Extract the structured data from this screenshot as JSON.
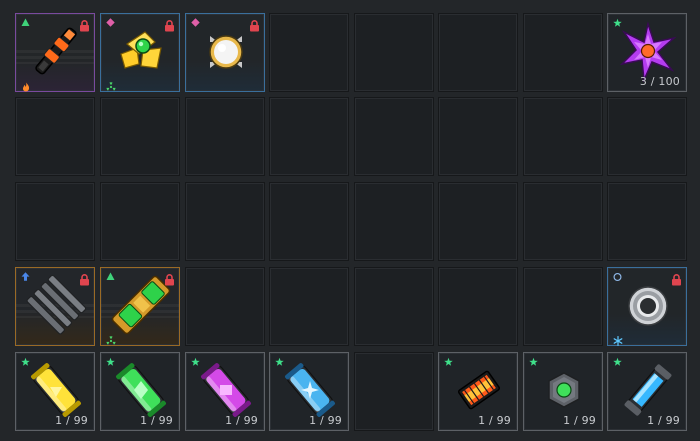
{
  "inventory": {
    "columns": 8,
    "rows": 5,
    "slots": [
      {
        "row": 0,
        "col": 0,
        "item": "orange-rod-icon",
        "rarity": "purple",
        "badge": "green-triangle",
        "locked": true,
        "sub": "fire-icon"
      },
      {
        "row": 0,
        "col": 1,
        "item": "yellow-turret-icon",
        "rarity": "blue",
        "badge": "pink-diamond",
        "locked": true,
        "sub": "radiation-icon"
      },
      {
        "row": 0,
        "col": 2,
        "item": "white-orb-icon",
        "rarity": "blue",
        "badge": "pink-diamond",
        "locked": true
      },
      {
        "row": 0,
        "col": 7,
        "item": "purple-shuriken-icon",
        "rarity": "gray",
        "badge": "green-star",
        "count": "3 / 100"
      },
      {
        "row": 3,
        "col": 0,
        "item": "gray-coil-icon",
        "rarity": "orange",
        "badge": "blue-arrow",
        "locked": true
      },
      {
        "row": 3,
        "col": 1,
        "item": "gold-green-cannon-icon",
        "rarity": "orange",
        "badge": "green-triangle",
        "locked": true,
        "sub": "radiation-icon"
      },
      {
        "row": 3,
        "col": 7,
        "item": "silver-ring-icon",
        "rarity": "blue",
        "badge": "blue-circle",
        "locked": true,
        "sub": "snowflake-icon"
      },
      {
        "row": 4,
        "col": 0,
        "item": "yellow-capsule-icon",
        "rarity": "gray",
        "badge": "green-star",
        "count": "1 / 99"
      },
      {
        "row": 4,
        "col": 1,
        "item": "green-capsule-icon",
        "rarity": "gray",
        "badge": "green-star",
        "count": "1 / 99"
      },
      {
        "row": 4,
        "col": 2,
        "item": "magenta-capsule-icon",
        "rarity": "gray",
        "badge": "green-star",
        "count": "1 / 99"
      },
      {
        "row": 4,
        "col": 3,
        "item": "blue-capsule-icon",
        "rarity": "gray",
        "badge": "green-star",
        "count": "1 / 99"
      },
      {
        "row": 4,
        "col": 5,
        "item": "heat-block-icon",
        "rarity": "gray",
        "badge": "green-star",
        "count": "1 / 99"
      },
      {
        "row": 4,
        "col": 6,
        "item": "green-hex-nut-icon",
        "rarity": "gray",
        "badge": "green-star",
        "count": "1 / 99"
      },
      {
        "row": 4,
        "col": 7,
        "item": "blue-vial-icon",
        "rarity": "gray",
        "badge": "green-star",
        "count": "1 / 99"
      }
    ]
  },
  "colors": {
    "rarity_purple": "#7a4a9e",
    "rarity_blue": "#3a6f9c",
    "rarity_orange": "#9a6a25",
    "rarity_gray": "#5d6166",
    "lock": "#e0454f"
  }
}
